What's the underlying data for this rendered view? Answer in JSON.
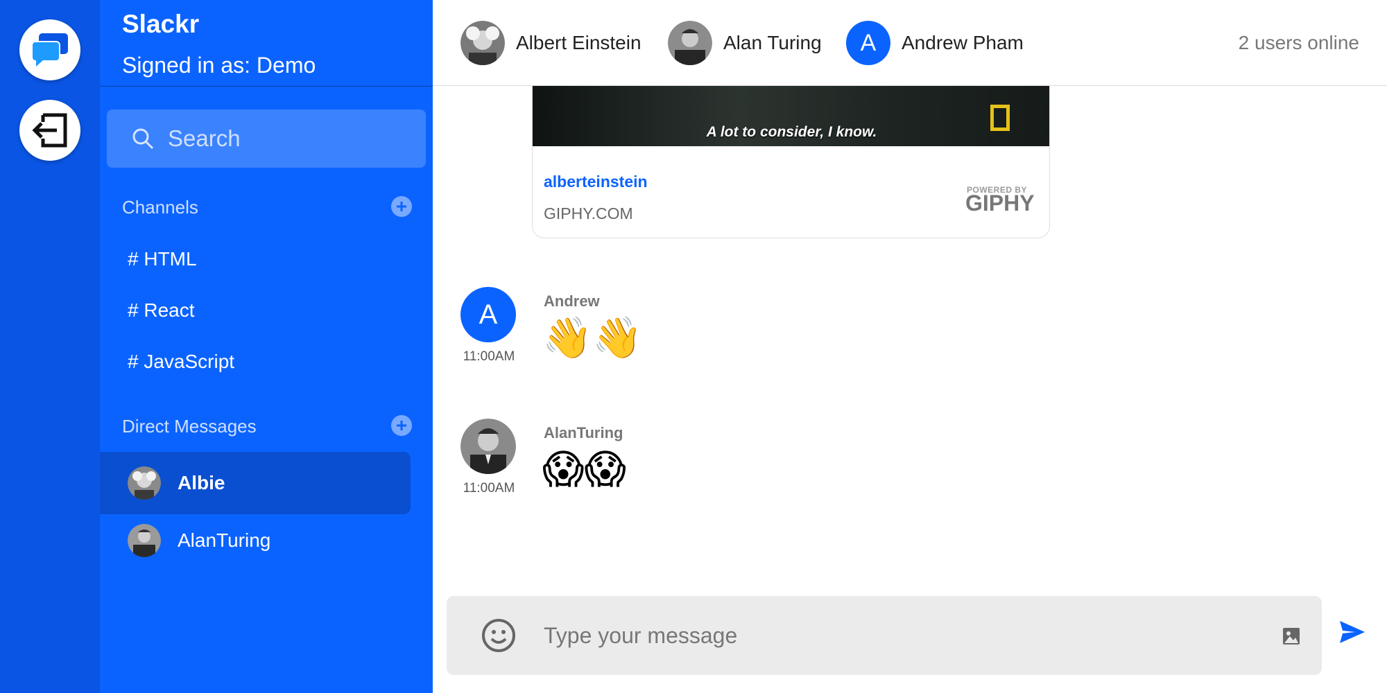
{
  "app": {
    "name": "Slackr",
    "signed_in": "Signed in as: Demo"
  },
  "search": {
    "placeholder": "Search"
  },
  "sidebar": {
    "channels_label": "Channels",
    "channels": [
      "# HTML",
      "# React",
      "# JavaScript"
    ],
    "dms_label": "Direct Messages",
    "dms": [
      {
        "name": "Albie",
        "active": true
      },
      {
        "name": "AlanTuring",
        "active": false
      }
    ]
  },
  "header": {
    "members": [
      {
        "name": "Albert Einstein",
        "avatar": "photo"
      },
      {
        "name": "Alan Turing",
        "avatar": "photo"
      },
      {
        "name": "Andrew Pham",
        "avatar": "letter",
        "letter": "A"
      }
    ],
    "online": "2 users online"
  },
  "gif": {
    "caption": "A lot to consider, I know.",
    "user": "alberteinstein",
    "domain": "GIPHY.COM",
    "powered_by": "POWERED BY",
    "brand": "GIPHY"
  },
  "messages": [
    {
      "author": "Andrew",
      "time": "11:00AM",
      "avatar_letter": "A",
      "body": "👋👋"
    },
    {
      "author": "AlanTuring",
      "time": "11:00AM",
      "body": "😱😱"
    }
  ],
  "composer": {
    "placeholder": "Type your message"
  },
  "colors": {
    "rail": "#0a55e3",
    "sidebar": "#0b63ff",
    "active_dm": "#0a4fd0",
    "accent": "#0b63ff"
  },
  "icons": [
    "chat-bubbles-icon",
    "logout-icon",
    "search-icon",
    "plus-icon",
    "emoji-icon",
    "image-icon",
    "send-icon"
  ]
}
